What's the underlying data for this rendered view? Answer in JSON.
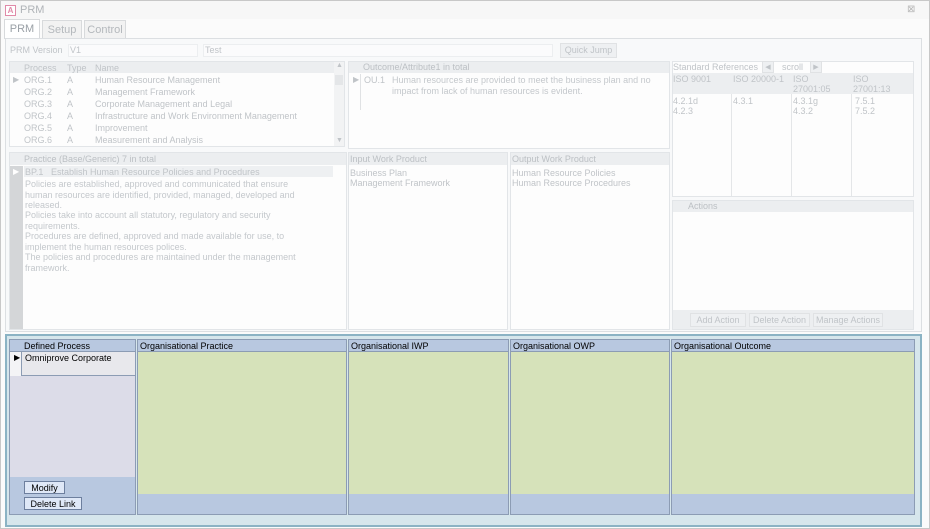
{
  "window": {
    "title": "PRM",
    "icon_letter": "A"
  },
  "tabs": [
    {
      "label": "PRM"
    },
    {
      "label": "Setup"
    },
    {
      "label": "Control"
    }
  ],
  "prm": {
    "version_label": "PRM Version",
    "version_value": "V1",
    "name_value": "Test",
    "quick_jump": "Quick Jump"
  },
  "process_grid": {
    "headers": {
      "process": "Process",
      "type": "Type",
      "name": "Name"
    },
    "rows": [
      {
        "process": "ORG.1",
        "type": "A",
        "name": "Human Resource Management"
      },
      {
        "process": "ORG.2",
        "type": "A",
        "name": "Management Framework"
      },
      {
        "process": "ORG.3",
        "type": "A",
        "name": "Corporate Management and Legal"
      },
      {
        "process": "ORG.4",
        "type": "A",
        "name": "Infrastructure and Work Environment Management"
      },
      {
        "process": "ORG.5",
        "type": "A",
        "name": "Improvement"
      },
      {
        "process": "ORG.6",
        "type": "A",
        "name": "Measurement and Analysis"
      }
    ]
  },
  "outcome": {
    "header": "Outcome/Attribute1 in total",
    "id": "OU.1",
    "text": "Human resources are provided to meet the business plan and no impact from lack of human resources is evident."
  },
  "std_refs": {
    "header": "Standard References",
    "scroll_label": "scroll",
    "columns": [
      {
        "name": "ISO 9001",
        "values": [
          "4.2.1d",
          "4.2.3"
        ]
      },
      {
        "name": "ISO 20000-1",
        "values": [
          "4.3.1"
        ]
      },
      {
        "name": "ISO 27001:05",
        "values": [
          "4.3.1g",
          "4.3.2"
        ]
      },
      {
        "name": "ISO 27001:13",
        "values": [
          "7.5.1",
          "7.5.2"
        ]
      }
    ]
  },
  "practice": {
    "header": "Practice (Base/Generic) 7 in total",
    "id": "BP.1",
    "name": "Establish Human Resource Policies and Procedures",
    "description": [
      "Policies are established, approved and communicated that ensure human resources are identified, provided, managed, developed and released.",
      "Policies take into account all statutory, regulatory and security requirements.",
      "Procedures are defined, approved and made available for use, to implement the human resources polices.",
      "The policies and procedures are maintained under the management framework."
    ]
  },
  "input_wp": {
    "header": "Input Work Product",
    "items": [
      "Business Plan",
      "Management Framework"
    ]
  },
  "output_wp": {
    "header": "Output Work Product",
    "items": [
      "Human Resource Policies",
      "Human Resource Procedures"
    ]
  },
  "actions": {
    "header": "Actions",
    "add": "Add Action",
    "delete": "Delete Action",
    "manage": "Manage Actions"
  },
  "lower": {
    "defined_process_header": "Defined Process",
    "defined_process_rows": [
      "Omniprove Corporate"
    ],
    "modify": "Modify",
    "delete_link": "Delete Link",
    "columns": [
      {
        "header": "Organisational Practice"
      },
      {
        "header": "Organisational IWP"
      },
      {
        "header": "Organisational OWP"
      },
      {
        "header": "Organisational Outcome"
      }
    ]
  },
  "colors": {
    "panel_green": "#d6e2ba",
    "header_blue": "#b8c8e0",
    "frame_teal": "#8bb3c4"
  }
}
